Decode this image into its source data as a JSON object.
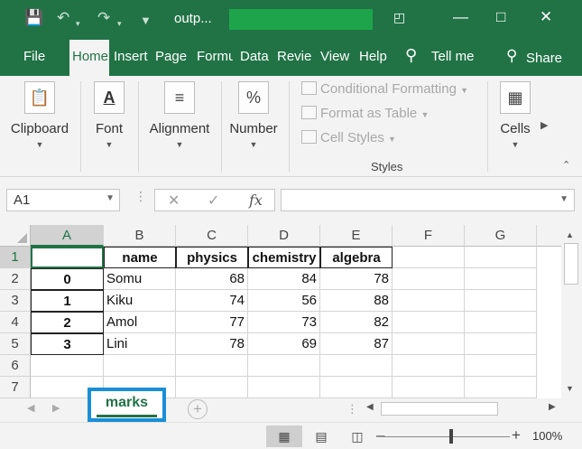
{
  "titlebar": {
    "title": "outp...",
    "icons": [
      "save-icon",
      "undo-icon",
      "redo-icon",
      "customize-icon"
    ],
    "window_buttons": [
      "ribbon-display-icon",
      "minimize-icon",
      "maximize-icon",
      "close-icon"
    ]
  },
  "ribbon_tabs": [
    "File",
    "Home",
    "Insert",
    "Page I",
    "Formu",
    "Data",
    "Revie",
    "View",
    "Help"
  ],
  "tell_me": "Tell me",
  "share": "Share",
  "ribbon": {
    "clipboard": "Clipboard",
    "font": "Font",
    "alignment": "Alignment",
    "number": "Number",
    "cells": "Cells",
    "styles": {
      "items": [
        "Conditional Formatting",
        "Format as Table",
        "Cell Styles"
      ],
      "label": "Styles"
    }
  },
  "formula_bar": {
    "name_box": "A1",
    "fx": "fx",
    "value": ""
  },
  "grid": {
    "columns": [
      "A",
      "B",
      "C",
      "D",
      "E",
      "F",
      "G"
    ],
    "rows": [
      "1",
      "2",
      "3",
      "4",
      "5",
      "6",
      "7"
    ],
    "header": [
      "",
      "name",
      "physics",
      "chemistry",
      "algebra"
    ],
    "data": [
      [
        "0",
        "Somu",
        "68",
        "84",
        "78"
      ],
      [
        "1",
        "Kiku",
        "74",
        "56",
        "88"
      ],
      [
        "2",
        "Amol",
        "77",
        "73",
        "82"
      ],
      [
        "3",
        "Lini",
        "78",
        "69",
        "87"
      ]
    ]
  },
  "sheets": [
    "marks"
  ],
  "status": {
    "zoom": "100%"
  }
}
